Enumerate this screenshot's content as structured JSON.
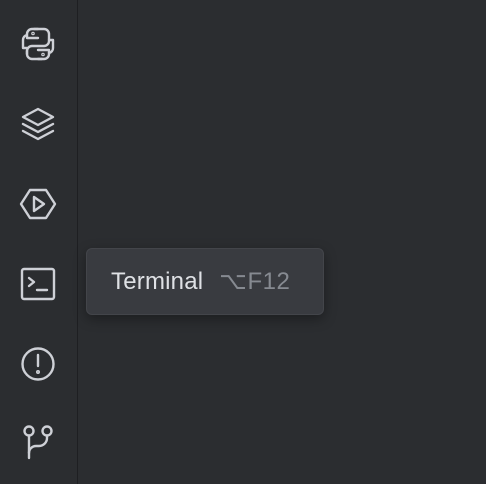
{
  "toolbar": {
    "buttons": [
      {
        "name": "python-console",
        "icon": "python-icon"
      },
      {
        "name": "services",
        "icon": "layers-icon"
      },
      {
        "name": "run",
        "icon": "run-hexagon-icon"
      },
      {
        "name": "terminal",
        "icon": "terminal-icon"
      },
      {
        "name": "problems",
        "icon": "exclamation-circle-icon"
      },
      {
        "name": "git",
        "icon": "git-branch-icon"
      }
    ]
  },
  "tooltip": {
    "label": "Terminal",
    "shortcut": "⌥F12"
  },
  "colors": {
    "background": "#2b2d30",
    "icon": "#ced0d6",
    "tooltip_background": "#393b40",
    "tooltip_text": "#dfe1e5",
    "tooltip_shortcut": "#868a91"
  }
}
